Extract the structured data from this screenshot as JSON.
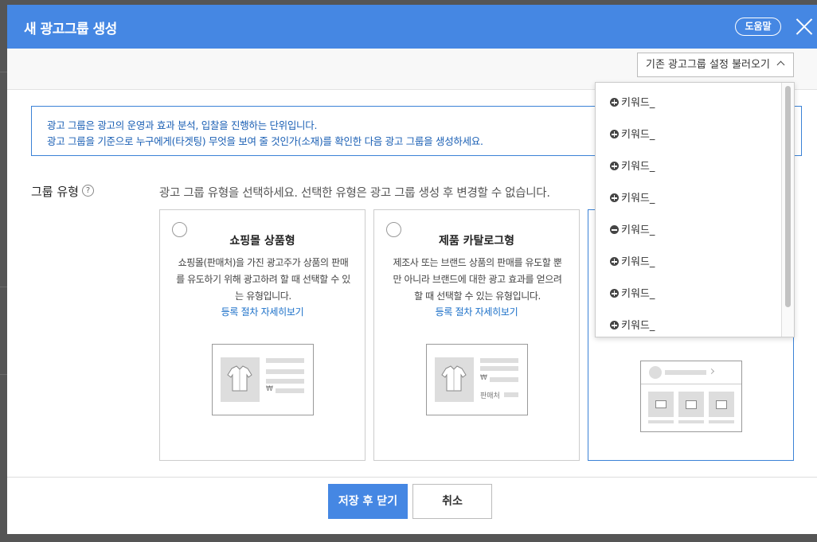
{
  "modal": {
    "title": "새 광고그룹 생성",
    "help_label": "도움말",
    "load_settings_label": "기존 광고그룹 설정 불러오기"
  },
  "info": {
    "line1": "광고 그룹은 광고의 운영과 효과 분석, 입찰을 진행하는 단위입니다.",
    "line2": "광고 그룹을 기준으로 누구에게(타겟팅) 무엇을 보여 줄 것인가(소재)를 확인한 다음 광고 그룹을 생성하세요."
  },
  "group_type": {
    "label": "그룹 유형",
    "help_glyph": "?",
    "description": "광고 그룹 유형을 선택하세요. 선택한 유형은 광고 그룹 생성 후 변경할 수 없습니다.",
    "cards": [
      {
        "title": "쇼핑몰 상품형",
        "desc": "쇼핑몰(판매처)을 가진 광고주가 상품의 판매를 유도하기 위해 광고하려 할 때 선택할 수 있는 유형입니다.",
        "link": "등록 절차 자세히보기",
        "won": "₩"
      },
      {
        "title": "제품 카탈로그형",
        "desc": "제조사 또는 브랜드 상품의 판매를 유도할 뿐만 아니라 브랜드에 대한 광고 효과를 얻으려 할 때 선택할 수 있는 유형입니다.",
        "link": "등록 절차 자세히보기",
        "won": "₩",
        "seller": "판매처"
      }
    ]
  },
  "dropdown": {
    "items": [
      {
        "label": "키워드_",
        "icon": "plus"
      },
      {
        "label": "키워드_",
        "icon": "plus"
      },
      {
        "label": "키워드_",
        "icon": "plus"
      },
      {
        "label": "키워드_",
        "icon": "plus"
      },
      {
        "label": "키워드_",
        "icon": "minus"
      },
      {
        "label": "키워드_",
        "icon": "plus"
      },
      {
        "label": "키워드_",
        "icon": "plus"
      },
      {
        "label": "키워드_",
        "icon": "plus"
      }
    ]
  },
  "footer": {
    "save_label": "저장 후 닫기",
    "cancel_label": "취소"
  },
  "colors": {
    "header": "#4587e3",
    "accent": "#3b82d6",
    "link": "#1a6fc8"
  }
}
